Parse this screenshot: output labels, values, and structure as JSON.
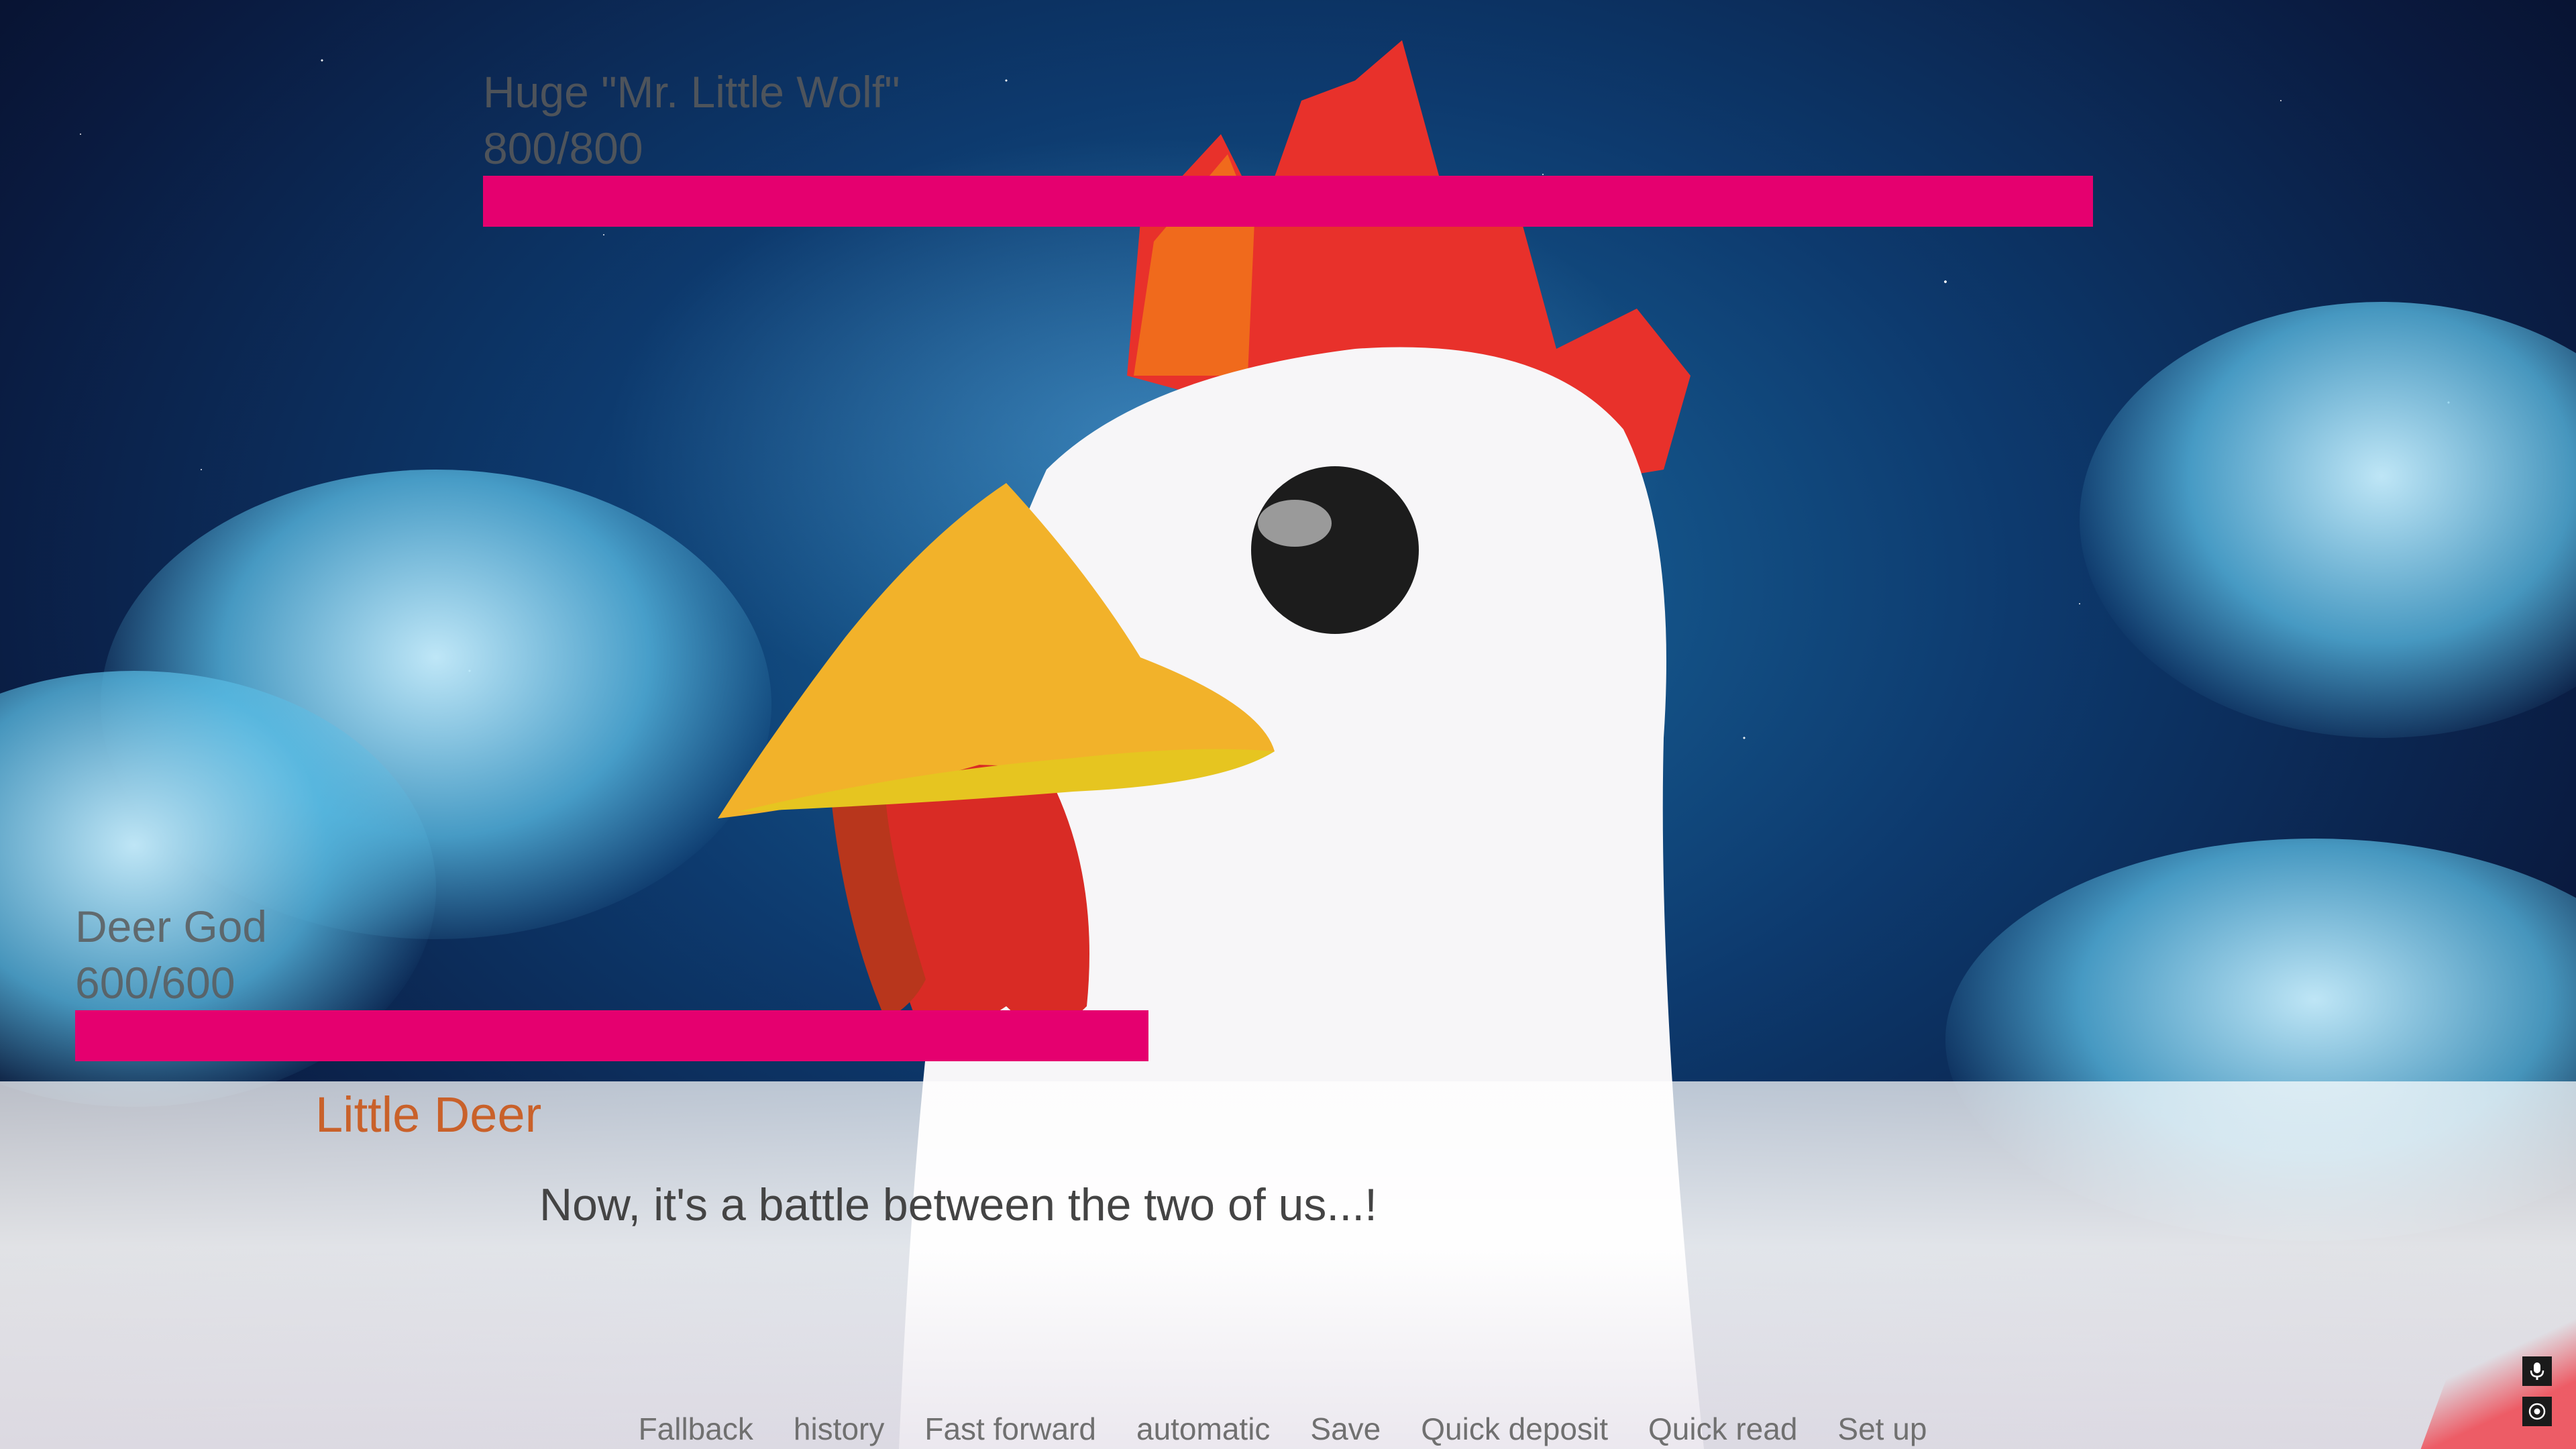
{
  "enemy_hp": {
    "name": "Huge \"Mr. Little Wolf\"",
    "value": "800/800",
    "current": 800,
    "max": 800,
    "fill_fraction": 1.0
  },
  "player_hp": {
    "name": "Deer God",
    "value": "600/600",
    "current": 600,
    "max": 600,
    "fill_fraction": 1.0
  },
  "dialogue": {
    "speaker": "Little Deer",
    "text": "Now, it's a battle between the two of us...!"
  },
  "quick_menu": {
    "fallback": "Fallback",
    "history": "history",
    "fast_forward": "Fast forward",
    "automatic": "automatic",
    "save": "Save",
    "quick_deposit": "Quick deposit",
    "quick_read": "Quick read",
    "set_up": "Set up"
  },
  "side_icons": {
    "top": "microphone-icon",
    "bottom": "target-icon"
  },
  "colors": {
    "hp_bar": "#e5006f",
    "speaker_name": "#c9612a",
    "dialogue_text": "#444444",
    "menu_text": "#707070"
  }
}
